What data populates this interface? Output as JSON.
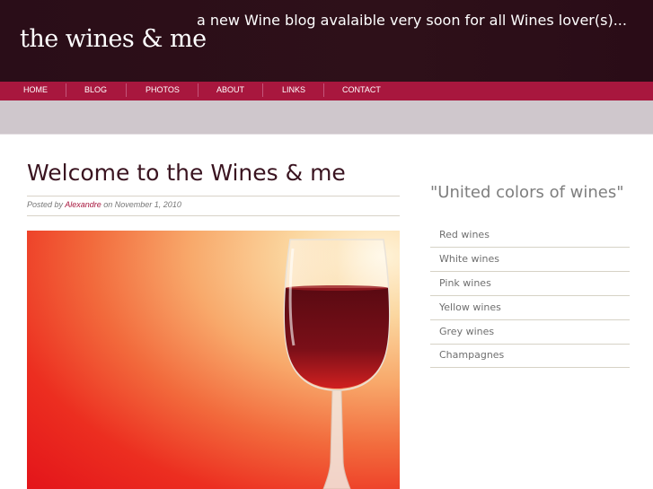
{
  "header": {
    "logo": "the wines & me",
    "tagline": "a new Wine blog avalaible very soon for all Wines lover(s)..."
  },
  "nav": {
    "items": [
      {
        "label": "HOME"
      },
      {
        "label": "BLOG"
      },
      {
        "label": "PHOTOS"
      },
      {
        "label": "ABOUT"
      },
      {
        "label": "LINKS"
      },
      {
        "label": "CONTACT"
      }
    ]
  },
  "post": {
    "title": "Welcome to the Wines & me",
    "posted_by": "Posted by",
    "author": "Alexandre",
    "on_label": "on",
    "date": "November 1, 2010",
    "image_icon": "wine-glass-icon"
  },
  "sidebar": {
    "title": "\"United colors of wines\"",
    "items": [
      {
        "label": "Red wines"
      },
      {
        "label": "White wines"
      },
      {
        "label": "Pink wines"
      },
      {
        "label": "Yellow wines"
      },
      {
        "label": "Grey wines"
      },
      {
        "label": "Champagnes"
      }
    ]
  },
  "colors": {
    "header_bg": "#2a0d18",
    "nav_bg": "#a8173e",
    "subbar_bg": "#cfc7cc",
    "title_color": "#3a1420",
    "author_color": "#a8173e"
  }
}
